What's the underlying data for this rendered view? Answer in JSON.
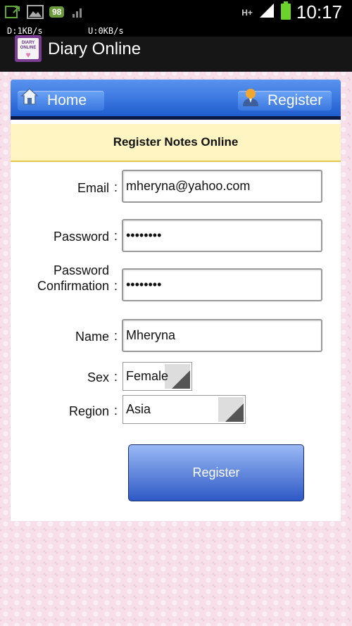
{
  "status_bar": {
    "time": "10:17",
    "network_type": "H+",
    "notification_badge": "98",
    "download_speed": "D:1KB/s",
    "upload_speed": "U:0KB/s"
  },
  "app_bar": {
    "title": "Diary Online",
    "logo_text": "DIARY ONLINE"
  },
  "nav": {
    "home_label": "Home",
    "register_label": "Register"
  },
  "form": {
    "header": "Register Notes Online",
    "email": {
      "label": "Email",
      "value": "mheryna@yahoo.com"
    },
    "password": {
      "label": "Password",
      "value": "••••••••"
    },
    "password_confirmation": {
      "label_line1": "Password",
      "label_line2": "Confirmation",
      "value": "••••••••"
    },
    "name": {
      "label": "Name",
      "value": "Mheryna"
    },
    "sex": {
      "label": "Sex",
      "value": "Female"
    },
    "region": {
      "label": "Region",
      "value": "Asia"
    },
    "colon": ":",
    "submit_label": "Register"
  },
  "colors": {
    "nav_blue": "#1f5dcf",
    "header_yellow": "#fff5c2",
    "background_pink": "#f6dfe9",
    "logo_purple": "#7b3c93"
  },
  "icons": [
    "download-icon",
    "image-icon",
    "signal-icon",
    "battery-icon",
    "home-icon",
    "user-icon"
  ]
}
